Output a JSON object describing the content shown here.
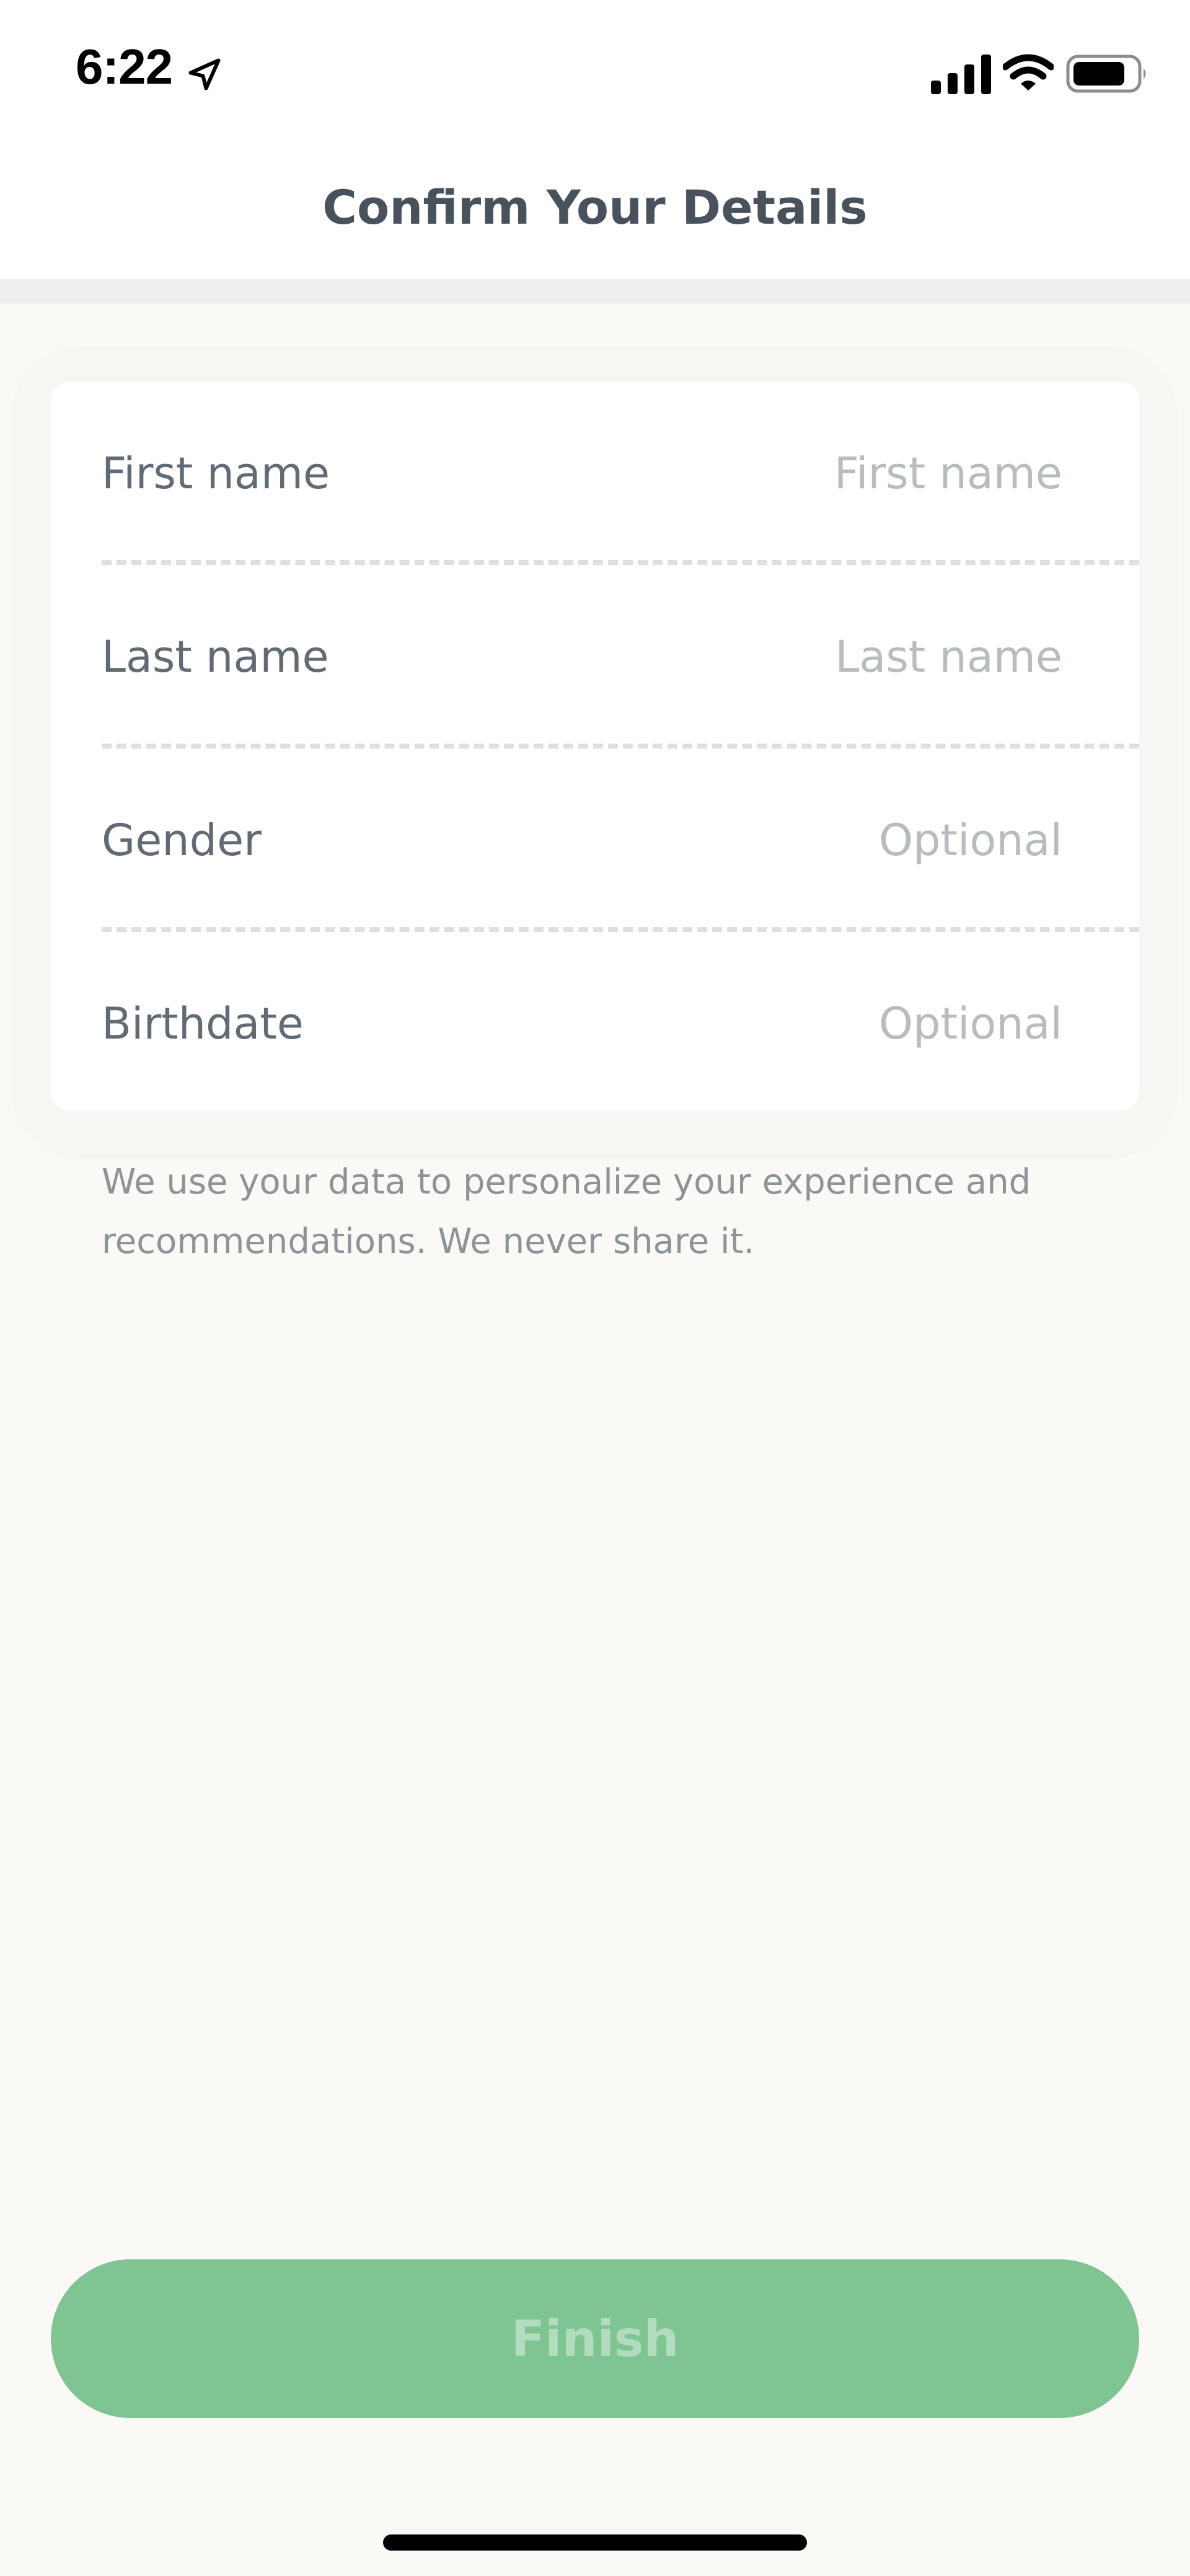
{
  "status_bar": {
    "time": "6:22",
    "icons": [
      "location-arrow-icon",
      "cellular-signal-icon",
      "wifi-icon",
      "battery-icon"
    ]
  },
  "header": {
    "title": "Confirm Your Details"
  },
  "form": {
    "fields": [
      {
        "label": "First name",
        "placeholder": "First name",
        "value": ""
      },
      {
        "label": "Last name",
        "placeholder": "Last name",
        "value": ""
      },
      {
        "label": "Gender",
        "placeholder": "Optional",
        "value": ""
      },
      {
        "label": "Birthdate",
        "placeholder": "Optional",
        "value": ""
      }
    ]
  },
  "disclaimer": "We use your data to personalize your experience and recommendations. We never share it.",
  "finish_button": {
    "label": "Finish",
    "disabled": true
  },
  "colors": {
    "accent": "#7fc591",
    "title": "#47525c",
    "label": "#616b75",
    "placeholder": "#b7bcbf",
    "background": "#faf9f6"
  }
}
